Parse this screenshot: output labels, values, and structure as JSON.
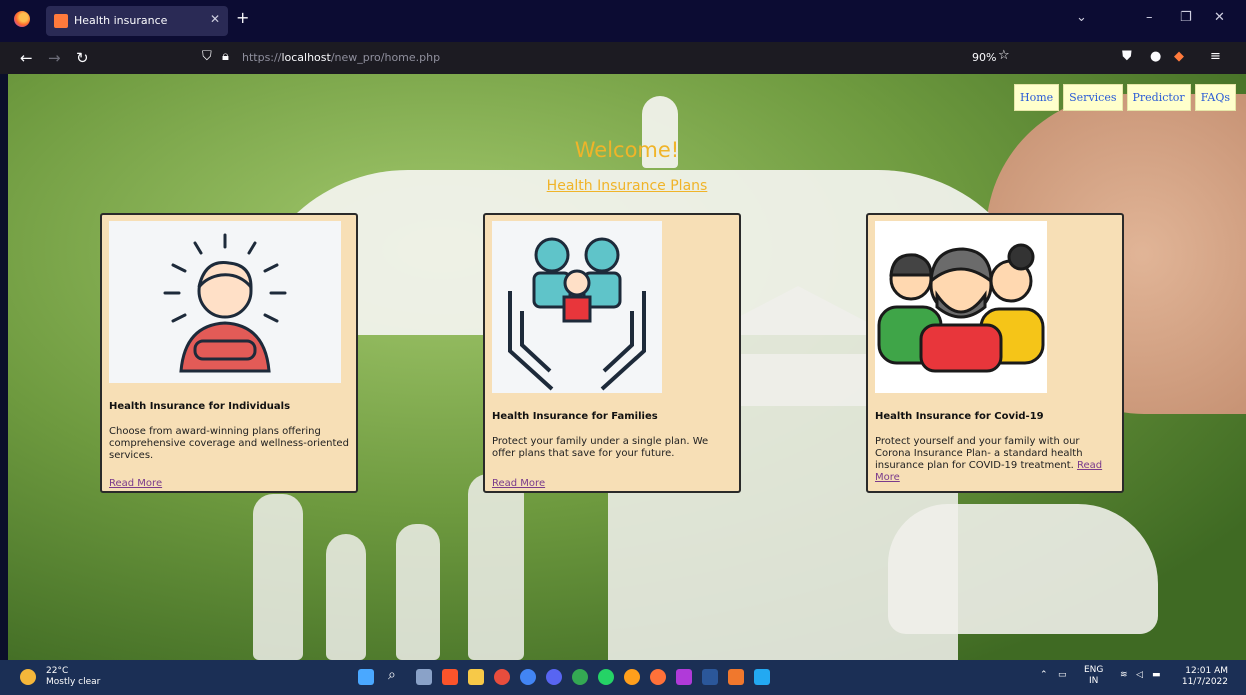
{
  "browser": {
    "tab_title": "Health insurance",
    "url_prefix": "https://",
    "url_host": "localhost",
    "url_path": "/new_pro/home.php",
    "zoom": "90%"
  },
  "nav": {
    "items": [
      "Home",
      "Services",
      "Predictor",
      "FAQs"
    ]
  },
  "page": {
    "welcome": "Welcome!",
    "plans_heading": "Health Insurance Plans",
    "read_more": "Read More",
    "cards": [
      {
        "title": "Health Insurance for Individuals",
        "text": "Choose from award-winning plans offering comprehensive coverage and wellness-oriented services."
      },
      {
        "title": "Health Insurance for Families",
        "text": "Protect your family under a single plan. We offer plans that save for your future."
      },
      {
        "title": "Health Insurance for Covid-19",
        "text": "Protect yourself and your family with our Corona Insurance Plan- a standard health insurance plan for COVID-19 treatment."
      }
    ]
  },
  "taskbar": {
    "temperature": "22°C",
    "weather": "Mostly clear",
    "lang": "ENG",
    "region": "IN",
    "time": "12:01 AM",
    "date": "11/7/2022"
  },
  "colors": {
    "accent": "#f0b429",
    "card_bg": "#f7dfb6",
    "nav_bg": "#ffffcc",
    "link": "#2a5bd7"
  }
}
